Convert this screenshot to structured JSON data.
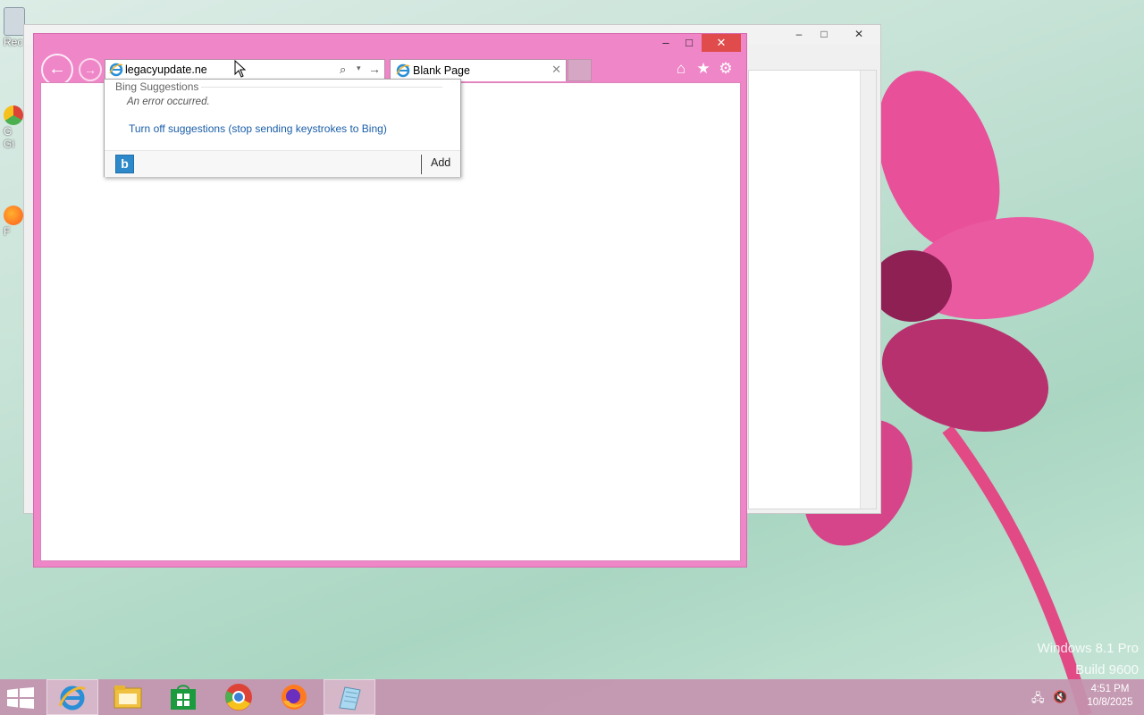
{
  "desktop": {
    "icon_labels": [
      "Rec",
      "G\nGi",
      "F"
    ],
    "watermark": {
      "line1": "Windows 8.1 Pro",
      "line2": "Build 9600"
    }
  },
  "background_window": {
    "min_glyph": "–",
    "max_glyph": "□",
    "close_glyph": "✕"
  },
  "ie": {
    "window_controls": {
      "min": "–",
      "max": "□",
      "close": "✕"
    },
    "nav": {
      "back_glyph": "←",
      "forward_glyph": "→"
    },
    "address_bar": {
      "value": "legacyupdate.ne",
      "search_glyph": "⌕",
      "dropdown_glyph": "▾",
      "go_glyph": "→"
    },
    "tab": {
      "title": "Blank Page",
      "close_glyph": "✕"
    },
    "toolbar": {
      "home_glyph": "⌂",
      "favorites_glyph": "★",
      "tools_glyph": "⚙"
    }
  },
  "suggestions": {
    "header": "Bing Suggestions",
    "error": "An error occurred.",
    "turn_off_link": "Turn off suggestions (stop sending keystrokes to Bing)",
    "bing_glyph": "b",
    "add_label": "Add"
  },
  "taskbar": {
    "apps": [
      "internet-explorer",
      "file-explorer",
      "store",
      "chrome",
      "firefox",
      "notepad"
    ],
    "clock": {
      "time": "4:51 PM",
      "date": "10/8/2025"
    }
  },
  "colors": {
    "ie_frame": "#ef86c8",
    "taskbar": "#c494b0",
    "link": "#1a5ea8"
  }
}
